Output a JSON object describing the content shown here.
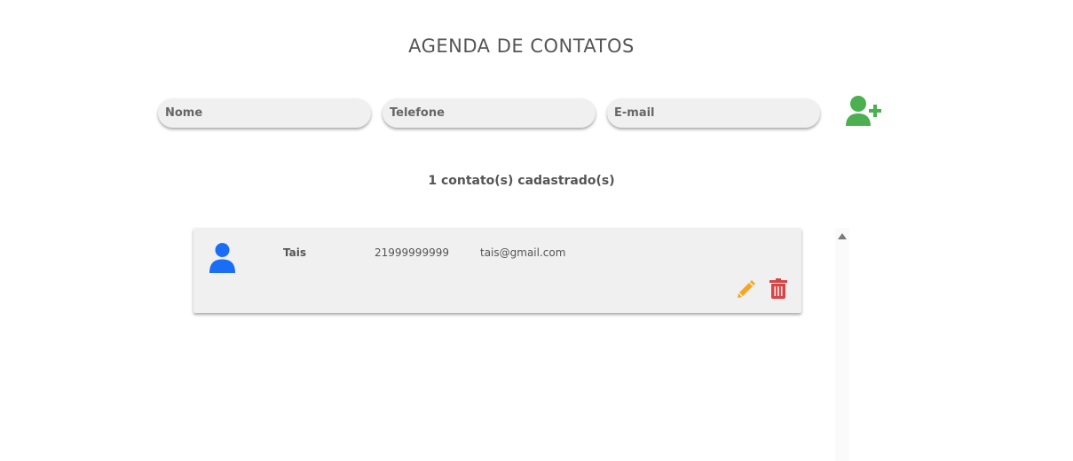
{
  "header": {
    "title": "AGENDA DE CONTATOS"
  },
  "form": {
    "name_placeholder": "Nome",
    "phone_placeholder": "Telefone",
    "email_placeholder": "E-mail",
    "add_icon": "user-plus-icon"
  },
  "summary": {
    "count_text": "1 contato(s) cadastrado(s)"
  },
  "contacts": [
    {
      "name": "Tais",
      "phone": "21999999999",
      "email": "tais@gmail.com",
      "avatar_icon": "user-icon",
      "edit_icon": "pencil-icon",
      "delete_icon": "trash-icon"
    }
  ],
  "colors": {
    "add_icon": "#4cb050",
    "avatar_icon": "#1a6ef5",
    "edit_icon": "#f5a623",
    "delete_icon": "#d64545",
    "card_background": "#f0f0f0",
    "text": "#555555"
  }
}
